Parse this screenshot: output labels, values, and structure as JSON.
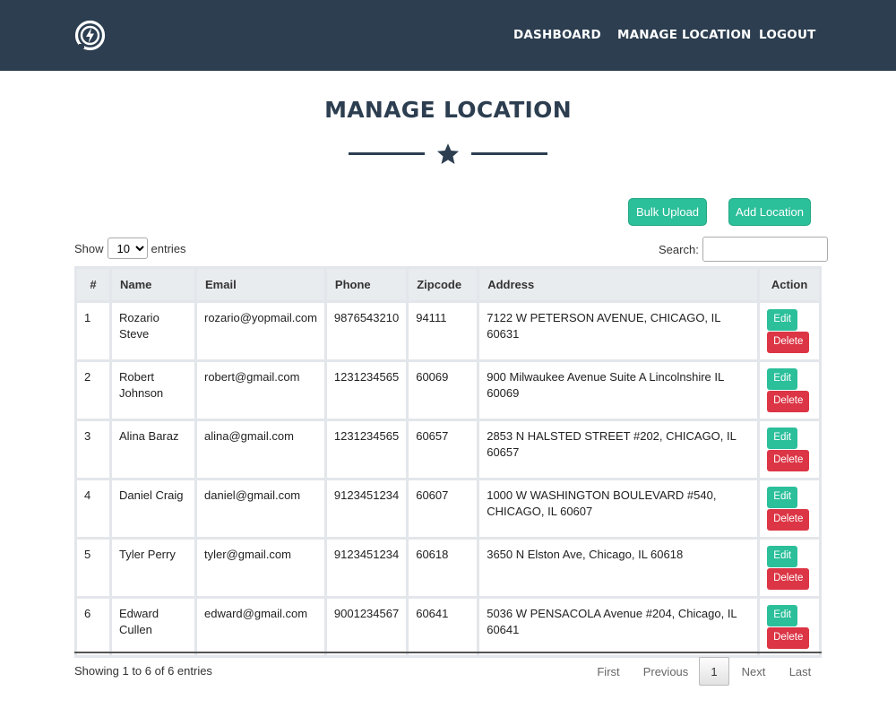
{
  "nav": {
    "logo": "lightning-bolt-logo",
    "items": [
      "DASHBOARD",
      "MANAGE LOCATION",
      "LOGOUT"
    ]
  },
  "page": {
    "title": "MANAGE LOCATION",
    "divider_icon": "star-icon"
  },
  "actions": {
    "bulk_upload": "Bulk Upload",
    "add_location": "Add Location"
  },
  "length_control": {
    "show_label": "Show",
    "selected": "10",
    "entries_label": "entries"
  },
  "search": {
    "label": "Search:",
    "value": ""
  },
  "table": {
    "columns": [
      "#",
      "Name",
      "Email",
      "Phone",
      "Zipcode",
      "Address",
      "Action"
    ],
    "rows": [
      {
        "num": "1",
        "name": "Rozario Steve",
        "email": "rozario@yopmail.com",
        "phone": "9876543210",
        "zipcode": "94111",
        "address": "7122 W PETERSON AVENUE, CHICAGO, IL 60631",
        "edit": "Edit",
        "delete": "Delete"
      },
      {
        "num": "2",
        "name": "Robert Johnson",
        "email": "robert@gmail.com",
        "phone": "1231234565",
        "zipcode": "60069",
        "address": "900 Milwaukee Avenue Suite A Lincolnshire IL 60069",
        "edit": "Edit",
        "delete": "Delete"
      },
      {
        "num": "3",
        "name": "Alina Baraz",
        "email": "alina@gmail.com",
        "phone": "1231234565",
        "zipcode": "60657",
        "address": "2853 N HALSTED STREET #202, CHICAGO, IL 60657",
        "edit": "Edit",
        "delete": "Delete"
      },
      {
        "num": "4",
        "name": "Daniel Craig",
        "email": "daniel@gmail.com",
        "phone": "9123451234",
        "zipcode": "60607",
        "address": "1000 W WASHINGTON BOULEVARD #540, CHICAGO, IL 60607",
        "edit": "Edit",
        "delete": "Delete"
      },
      {
        "num": "5",
        "name": "Tyler Perry",
        "email": "tyler@gmail.com",
        "phone": "9123451234",
        "zipcode": "60618",
        "address": "3650 N Elston Ave, Chicago, IL 60618",
        "edit": "Edit",
        "delete": "Delete"
      },
      {
        "num": "6",
        "name": "Edward Cullen",
        "email": "edward@gmail.com",
        "phone": "9001234567",
        "zipcode": "60641",
        "address": "5036 W PENSACOLA Avenue #204, Chicago, IL 60641",
        "edit": "Edit",
        "delete": "Delete"
      }
    ]
  },
  "footer": {
    "info": "Showing 1 to 6 of 6 entries",
    "pagination": {
      "first": "First",
      "previous": "Previous",
      "current": "1",
      "next": "Next",
      "last": "Last"
    }
  },
  "colors": {
    "navbar": "#2c3e50",
    "accent_green": "#2bbf9a",
    "danger_red": "#dc3545"
  }
}
